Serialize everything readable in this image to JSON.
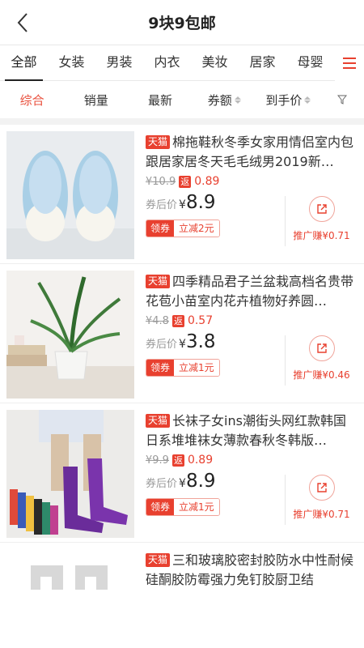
{
  "header": {
    "title": "9块9包邮"
  },
  "categories": [
    "全部",
    "女装",
    "男装",
    "内衣",
    "美妆",
    "居家",
    "母婴"
  ],
  "sorts": [
    {
      "label": "综合",
      "active": true
    },
    {
      "label": "销量"
    },
    {
      "label": "最新"
    },
    {
      "label": "券额"
    },
    {
      "label": "到手价"
    }
  ],
  "products": [
    {
      "badge": "天猫",
      "name": "棉拖鞋秋冬季女家用情侣室内包跟居家居冬天毛毛绒男2019新…",
      "orig": "¥10.9",
      "rebate_label": "返",
      "rebate": "0.89",
      "after_label": "券后价",
      "yen": "¥",
      "price": "8.9",
      "coupon_label": "领券",
      "coupon_value": "立减2元",
      "promo": "推广赚¥0.71",
      "image": "slippers"
    },
    {
      "badge": "天猫",
      "name": "四季精品君子兰盆栽高档名贵带花苞小苗室内花卉植物好养圆…",
      "orig": "¥4.8",
      "rebate_label": "返",
      "rebate": "0.57",
      "after_label": "券后价",
      "yen": "¥",
      "price": "3.8",
      "coupon_label": "领券",
      "coupon_value": "立减1元",
      "promo": "推广赚¥0.46",
      "image": "plant"
    },
    {
      "badge": "天猫",
      "name": "长袜子女ins潮街头网红款韩国日系堆堆袜女薄款春秋冬韩版…",
      "orig": "¥9.9",
      "rebate_label": "返",
      "rebate": "0.89",
      "after_label": "券后价",
      "yen": "¥",
      "price": "8.9",
      "coupon_label": "领券",
      "coupon_value": "立减1元",
      "promo": "推广赚¥0.71",
      "image": "socks"
    },
    {
      "badge": "天猫",
      "name": "三和玻璃胶密封胶防水中性耐候硅酮胶防霉强力免钉胶厨卫结",
      "image": "glue"
    }
  ],
  "colors": {
    "accent": "#e8402f",
    "active_sort": "#e94f3c"
  }
}
